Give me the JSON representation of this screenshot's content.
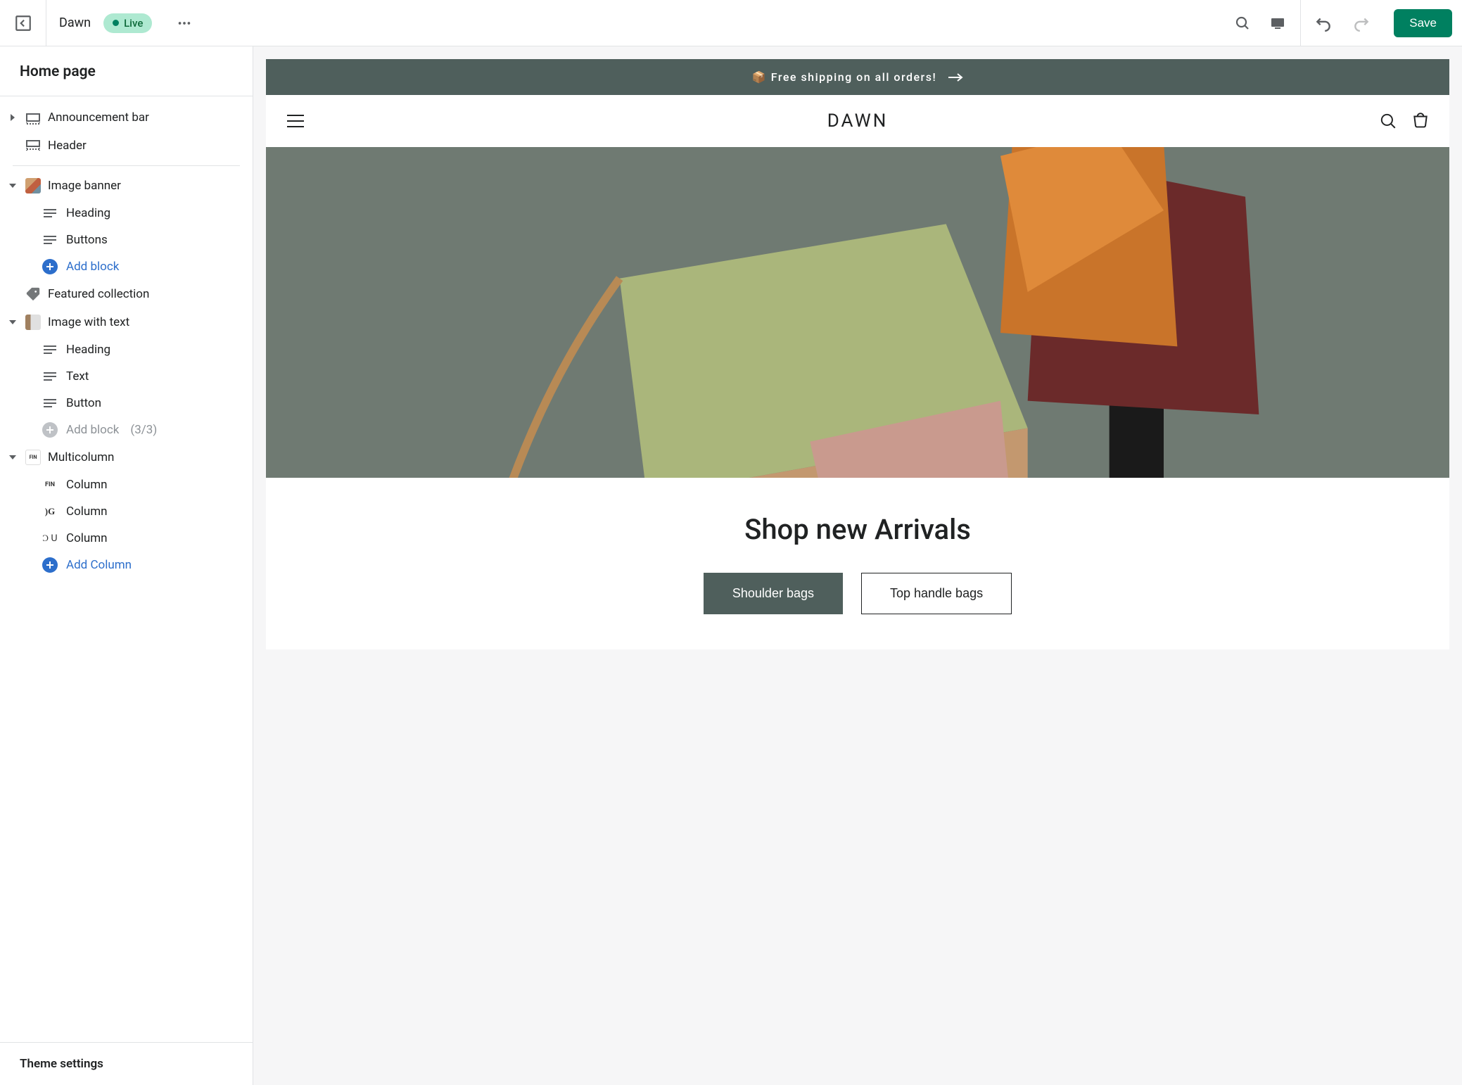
{
  "topbar": {
    "theme_name": "Dawn",
    "live_badge": "Live",
    "save_label": "Save"
  },
  "sidebar": {
    "title": "Home page",
    "theme_settings_label": "Theme settings",
    "sections": {
      "announcement": "Announcement bar",
      "header": "Header",
      "image_banner": {
        "label": "Image banner",
        "children": [
          "Heading",
          "Buttons"
        ],
        "add_label": "Add block"
      },
      "featured_collection": "Featured collection",
      "image_with_text": {
        "label": "Image with text",
        "children": [
          "Heading",
          "Text",
          "Button"
        ],
        "add_label": "Add block",
        "add_count": "(3/3)"
      },
      "multicolumn": {
        "label": "Multicolumn",
        "children": [
          "Column",
          "Column",
          "Column"
        ],
        "add_label": "Add Column"
      }
    }
  },
  "preview": {
    "announcement_text": "📦 Free shipping on all orders!",
    "brand": "DAWN",
    "hero_title": "Shop new Arrivals",
    "btn_primary": "Shoulder bags",
    "btn_secondary": "Top handle bags"
  }
}
